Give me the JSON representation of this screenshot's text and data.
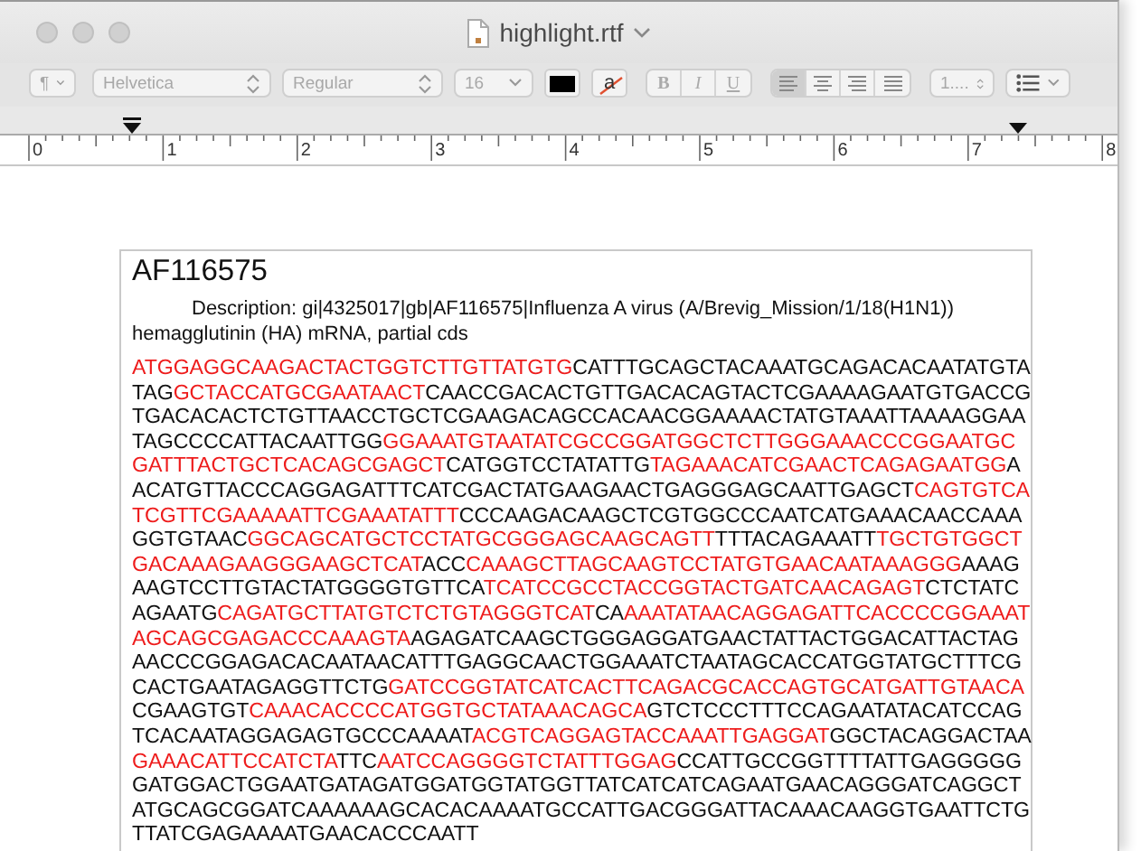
{
  "window": {
    "title": "highlight.rtf"
  },
  "toolbar": {
    "paragraph_style": "¶",
    "font": "Helvetica",
    "typeface": "Regular",
    "size": "16",
    "highlight_glyph": "a",
    "bold": "B",
    "italic": "I",
    "underline": "U",
    "alignment": [
      {
        "kind": "left",
        "selected": true
      },
      {
        "kind": "center",
        "selected": false
      },
      {
        "kind": "right",
        "selected": false
      },
      {
        "kind": "justify",
        "selected": false
      }
    ],
    "line_spacing": "1...."
  },
  "ruler": {
    "labels": [
      "0",
      "1",
      "2",
      "3",
      "4",
      "5",
      "6",
      "7",
      "8"
    ]
  },
  "document": {
    "heading": "AF116575",
    "description": "Description: gi|4325017|gb|AF116575|Influenza A virus (A/Brevig_Mission/1/18(H1N1)) hemagglutinin (HA) mRNA, partial cds",
    "sequence_lines": [
      [
        {
          "text": "ATGGAGGCAAGACTACTGGTCTTGTTATGTG",
          "highlighted": true
        },
        {
          "text": "CATTTGCAGCTACAAATGCAGACACAATATGTA",
          "highlighted": false
        }
      ],
      [
        {
          "text": "TAG",
          "highlighted": false
        },
        {
          "text": "GCTACCATGCGAATAACT",
          "highlighted": true
        },
        {
          "text": "CAACCGACACTGTTGACACAGTACTCGAAAAGAATGTGACCG",
          "highlighted": false
        }
      ],
      [
        {
          "text": "TGACACACTCTGTTAACCTGCTCGAAGACAGCCACAACGGAAAACTATGTAAATTAAAAGGAA",
          "highlighted": false
        }
      ],
      [
        {
          "text": "TAGCCCCATTACAATTGG",
          "highlighted": false
        },
        {
          "text": "GGAAATGTAATATCGCCGGATGGCTCTTGGGAAACCCGGAATGC",
          "highlighted": true
        }
      ],
      [
        {
          "text": "GATTTACTGCTCACAGCGAGCT",
          "highlighted": true
        },
        {
          "text": "CATGGTCCTATATTG",
          "highlighted": false
        },
        {
          "text": "TAGAAACATCGAACTCAGAGAATGG",
          "highlighted": true
        },
        {
          "text": "A",
          "highlighted": false
        }
      ],
      [
        {
          "text": "ACATGTTACCCAGGAGATTTCATCGACTATGAAGAACTGAGGGAGCAATTGAGCT",
          "highlighted": false
        },
        {
          "text": "CAGTGTCA",
          "highlighted": true
        }
      ],
      [
        {
          "text": "TCGTTCGAAAAATTCGAAATATTT",
          "highlighted": true
        },
        {
          "text": "CCCAAGACAAGCTCGTGGCCCAATCATGAAACAACCAAA",
          "highlighted": false
        }
      ],
      [
        {
          "text": "GGTGTAAC",
          "highlighted": false
        },
        {
          "text": "GGCAGCATGCTCCTATGCGGGAGCAAGCAGTT",
          "highlighted": true
        },
        {
          "text": "TTTACAGAAATT",
          "highlighted": false
        },
        {
          "text": "TGCTGTGGCT",
          "highlighted": true
        }
      ],
      [
        {
          "text": "GACAAAGAAGGGAAGCTCAT",
          "highlighted": true
        },
        {
          "text": "ACC",
          "highlighted": false
        },
        {
          "text": "CAAAGCTTAGCAAGTCCTATGTGAACAATAAAGGG",
          "highlighted": true
        },
        {
          "text": "AAAG",
          "highlighted": false
        }
      ],
      [
        {
          "text": "AAGTCCTTGTACTATGGGGTGTTCA",
          "highlighted": false
        },
        {
          "text": "TCATCCGCCTACCGGTACTGATCAACAGAGT",
          "highlighted": true
        },
        {
          "text": "CTCTATC",
          "highlighted": false
        }
      ],
      [
        {
          "text": "AGAATG",
          "highlighted": false
        },
        {
          "text": "CAGATGCTTATGTCTCTGTAGGGTCAT",
          "highlighted": true
        },
        {
          "text": "CA",
          "highlighted": false
        },
        {
          "text": "AAATATAACAGGAGATTCACCCCGGAAAT",
          "highlighted": true
        }
      ],
      [
        {
          "text": "AGCAGCGAGACCCAAAGTA",
          "highlighted": true
        },
        {
          "text": "AGAGATCAAGCTGGGAGGATGAACTATTACTGGACATTACTAG",
          "highlighted": false
        }
      ],
      [
        {
          "text": "AACCCGGAGACACAATAACATTTGAGGCAACTGGAAATCTAATAGCACCATGGTATGCTTTCG",
          "highlighted": false
        }
      ],
      [
        {
          "text": "CACTGAATAGAGGTTCTG",
          "highlighted": false
        },
        {
          "text": "GATCCGGTATCATCACTTCAGACGCACCAGTGCATGATTGTAACA",
          "highlighted": true
        }
      ],
      [
        {
          "text": "CGAAGTGT",
          "highlighted": false
        },
        {
          "text": "CAAACACCCCATGGTGCTATAAACAGCA",
          "highlighted": true
        },
        {
          "text": "GTCTCCCTTTCCAGAATATACATCCAG",
          "highlighted": false
        }
      ],
      [
        {
          "text": "TCACAATAGGAGAGTGCCCAAAAT",
          "highlighted": false
        },
        {
          "text": "ACGTCAGGAGTACCAAATTGAGGAT",
          "highlighted": true
        },
        {
          "text": "GGCTACAGGACTAA",
          "highlighted": false
        }
      ],
      [
        {
          "text": "GAAACATTCCATCTA",
          "highlighted": true
        },
        {
          "text": "TTC",
          "highlighted": false
        },
        {
          "text": "AATCCAGGGGTCTATTTGGAG",
          "highlighted": true
        },
        {
          "text": "CCATTGCCGGTTTTATTGAGGGGG",
          "highlighted": false
        }
      ],
      [
        {
          "text": "GATGGACTGGAATGATAGATGGATGGTATGGTTATCATCATCAGAATGAACAGGGATCAGGCT",
          "highlighted": false
        }
      ],
      [
        {
          "text": "ATGCAGCGGATCAAAAAAGCACACAAAATGCCATTGACGGGATTACAAACAAGGTGAATTCTG",
          "highlighted": false
        }
      ],
      [
        {
          "text": "TTATCGAGAAAATGAACACCCAATT",
          "highlighted": false
        }
      ]
    ]
  }
}
